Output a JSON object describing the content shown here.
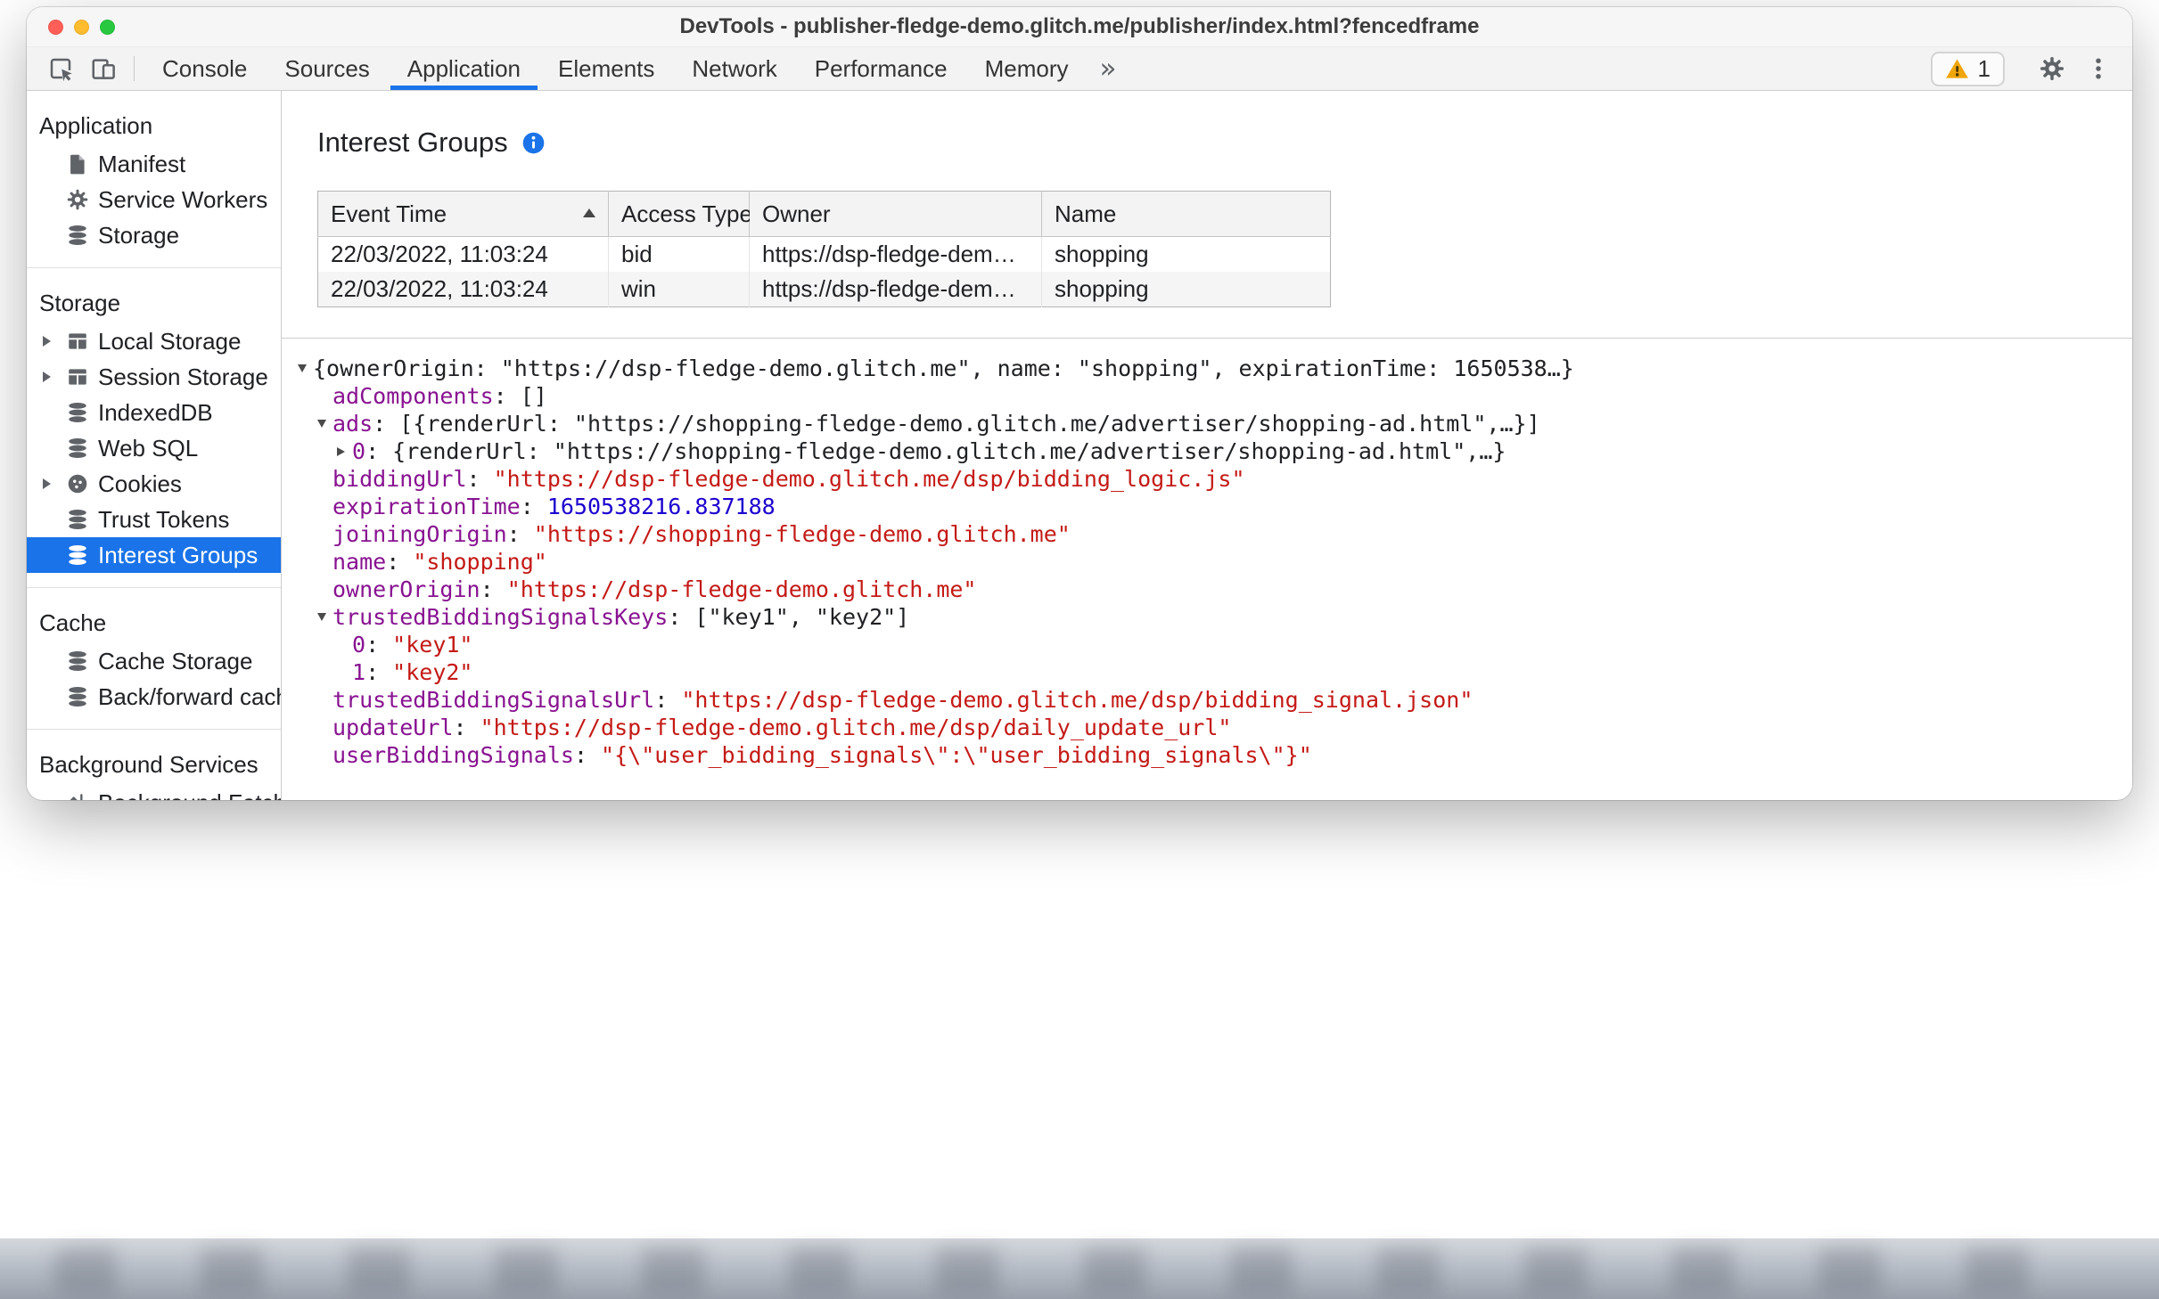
{
  "window": {
    "title": "DevTools - publisher-fledge-demo.glitch.me/publisher/index.html?fencedframe"
  },
  "toolbar": {
    "tabs": [
      "Console",
      "Sources",
      "Application",
      "Elements",
      "Network",
      "Performance",
      "Memory"
    ],
    "active_tab": "Application",
    "more_tabs_label": "»",
    "issues": {
      "warning_count": "1"
    }
  },
  "sidebar": {
    "sections": [
      {
        "header": "Application",
        "items": [
          {
            "label": "Manifest",
            "icon": "document"
          },
          {
            "label": "Service Workers",
            "icon": "gear"
          },
          {
            "label": "Storage",
            "icon": "database"
          }
        ]
      },
      {
        "header": "Storage",
        "items": [
          {
            "label": "Local Storage",
            "icon": "table",
            "expandable": true
          },
          {
            "label": "Session Storage",
            "icon": "table",
            "expandable": true
          },
          {
            "label": "IndexedDB",
            "icon": "database"
          },
          {
            "label": "Web SQL",
            "icon": "database"
          },
          {
            "label": "Cookies",
            "icon": "cookie",
            "expandable": true
          },
          {
            "label": "Trust Tokens",
            "icon": "database"
          },
          {
            "label": "Interest Groups",
            "icon": "database",
            "selected": true
          }
        ]
      },
      {
        "header": "Cache",
        "items": [
          {
            "label": "Cache Storage",
            "icon": "database"
          },
          {
            "label": "Back/forward cach",
            "icon": "database"
          }
        ]
      },
      {
        "header": "Background Services",
        "items": [
          {
            "label": "Background Fetch",
            "icon": "fetch"
          }
        ]
      }
    ]
  },
  "main": {
    "title": "Interest Groups",
    "table": {
      "columns": [
        "Event Time",
        "Access Type",
        "Owner",
        "Name"
      ],
      "sort": {
        "column": "Event Time",
        "direction": "ascending"
      },
      "rows": [
        [
          "22/03/2022, 11:03:24",
          "bid",
          "https://dsp-fledge-demo.glitch.me",
          "shopping"
        ],
        [
          "22/03/2022, 11:03:24",
          "win",
          "https://dsp-fledge-demo.glitch.me",
          "shopping"
        ]
      ]
    },
    "tree": {
      "lines": [
        {
          "indent": 0,
          "arrow": "open",
          "segs": [
            [
              "p",
              "{ownerOrigin: \"https://dsp-fledge-demo.glitch.me\", name: \"shopping\", expirationTime: 1650538…}"
            ]
          ]
        },
        {
          "indent": 1,
          "arrow": null,
          "segs": [
            [
              "k",
              "adComponents"
            ],
            [
              "p",
              ": []"
            ]
          ]
        },
        {
          "indent": 1,
          "arrow": "open",
          "segs": [
            [
              "k",
              "ads"
            ],
            [
              "p",
              ": [{renderUrl: \"https://shopping-fledge-demo.glitch.me/advertiser/shopping-ad.html\",…}]"
            ]
          ]
        },
        {
          "indent": 2,
          "arrow": "closed",
          "segs": [
            [
              "k",
              "0"
            ],
            [
              "p",
              ": {renderUrl: \"https://shopping-fledge-demo.glitch.me/advertiser/shopping-ad.html\",…}"
            ]
          ]
        },
        {
          "indent": 1,
          "arrow": null,
          "segs": [
            [
              "k",
              "biddingUrl"
            ],
            [
              "p",
              ": "
            ],
            [
              "s",
              "\"https://dsp-fledge-demo.glitch.me/dsp/bidding_logic.js\""
            ]
          ]
        },
        {
          "indent": 1,
          "arrow": null,
          "segs": [
            [
              "k",
              "expirationTime"
            ],
            [
              "p",
              ": "
            ],
            [
              "n",
              "1650538216.837188"
            ]
          ]
        },
        {
          "indent": 1,
          "arrow": null,
          "segs": [
            [
              "k",
              "joiningOrigin"
            ],
            [
              "p",
              ": "
            ],
            [
              "s",
              "\"https://shopping-fledge-demo.glitch.me\""
            ]
          ]
        },
        {
          "indent": 1,
          "arrow": null,
          "segs": [
            [
              "k",
              "name"
            ],
            [
              "p",
              ": "
            ],
            [
              "s",
              "\"shopping\""
            ]
          ]
        },
        {
          "indent": 1,
          "arrow": null,
          "segs": [
            [
              "k",
              "ownerOrigin"
            ],
            [
              "p",
              ": "
            ],
            [
              "s",
              "\"https://dsp-fledge-demo.glitch.me\""
            ]
          ]
        },
        {
          "indent": 1,
          "arrow": "open",
          "segs": [
            [
              "k",
              "trustedBiddingSignalsKeys"
            ],
            [
              "p",
              ": [\"key1\", \"key2\"]"
            ]
          ]
        },
        {
          "indent": 2,
          "arrow": null,
          "segs": [
            [
              "k",
              "0"
            ],
            [
              "p",
              ": "
            ],
            [
              "s",
              "\"key1\""
            ]
          ]
        },
        {
          "indent": 2,
          "arrow": null,
          "segs": [
            [
              "k",
              "1"
            ],
            [
              "p",
              ": "
            ],
            [
              "s",
              "\"key2\""
            ]
          ]
        },
        {
          "indent": 1,
          "arrow": null,
          "segs": [
            [
              "k",
              "trustedBiddingSignalsUrl"
            ],
            [
              "p",
              ": "
            ],
            [
              "s",
              "\"https://dsp-fledge-demo.glitch.me/dsp/bidding_signal.json\""
            ]
          ]
        },
        {
          "indent": 1,
          "arrow": null,
          "segs": [
            [
              "k",
              "updateUrl"
            ],
            [
              "p",
              ": "
            ],
            [
              "s",
              "\"https://dsp-fledge-demo.glitch.me/dsp/daily_update_url\""
            ]
          ]
        },
        {
          "indent": 1,
          "arrow": null,
          "segs": [
            [
              "k",
              "userBiddingSignals"
            ],
            [
              "p",
              ": "
            ],
            [
              "s",
              "\"{\\\"user_bidding_signals\\\":\\\"user_bidding_signals\\\"}\""
            ]
          ]
        }
      ]
    }
  },
  "colors": {
    "accent_blue": "#1a73e8",
    "key_purple": "#881391",
    "string_red": "#c41a16",
    "number_blue": "#1c00cf",
    "warning_yellow": "#f0a60a"
  }
}
